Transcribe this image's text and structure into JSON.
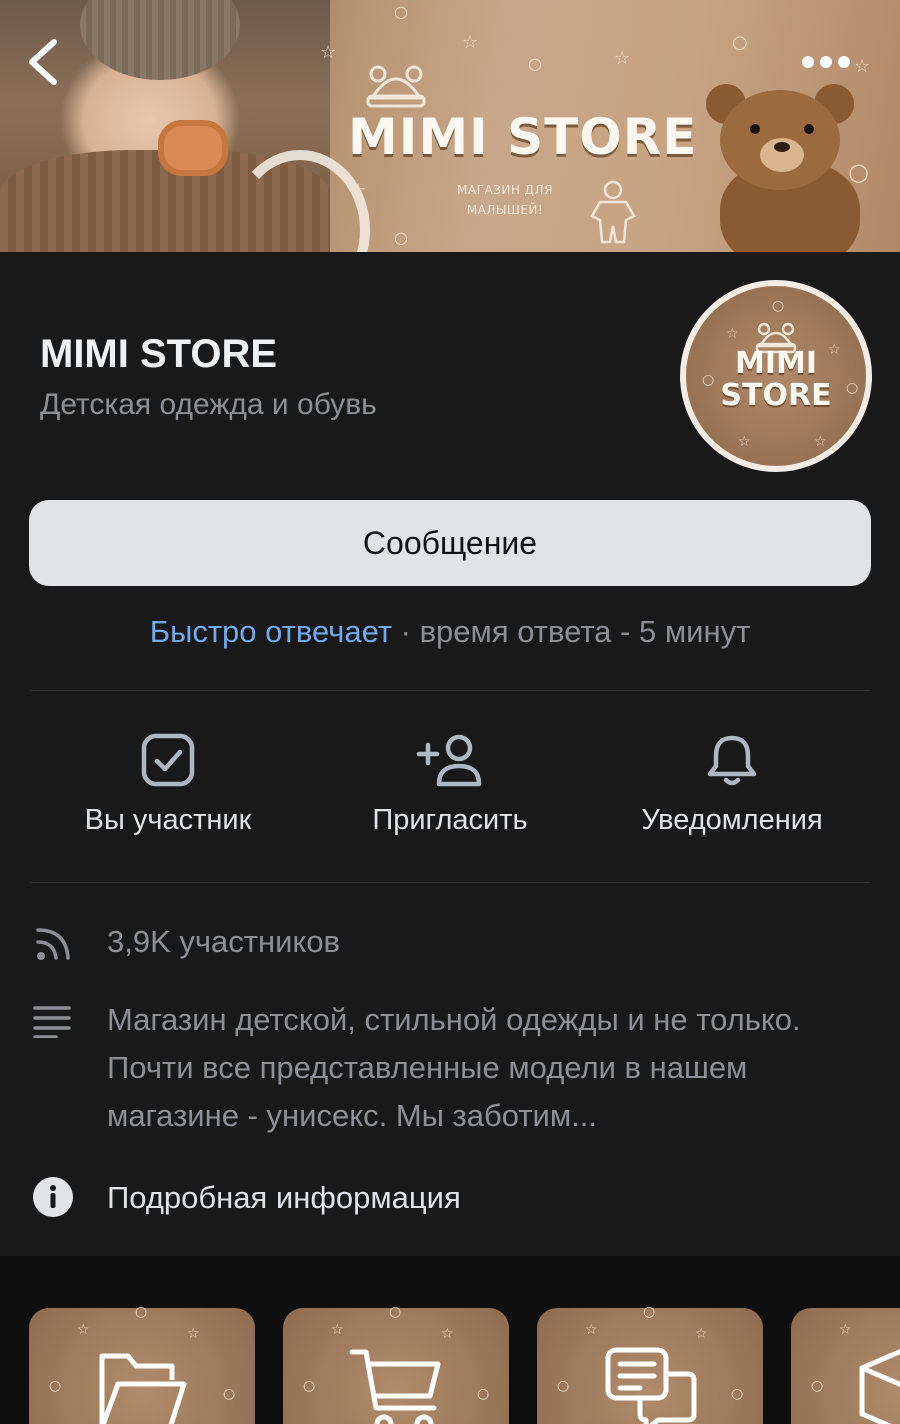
{
  "cover": {
    "brand": "MIMI STORE",
    "tagline_line1": "МАГАЗИН ДЛЯ",
    "tagline_line2": "МАЛЫШЕЙ!"
  },
  "header": {
    "back_icon": "chevron-left-icon",
    "more_icon": "more-dots-icon"
  },
  "profile": {
    "name": "MIMI STORE",
    "subtitle": "Детская одежда и обувь",
    "avatar_line1": "MIMI",
    "avatar_line2": "STORE"
  },
  "message_button": "Сообщение",
  "response": {
    "fast": "Быстро отвечает",
    "rest": " · время ответа - 5 минут"
  },
  "actions": [
    {
      "icon": "check-square-icon",
      "label": "Вы участник"
    },
    {
      "icon": "add-user-icon",
      "label": "Пригласить"
    },
    {
      "icon": "bell-icon",
      "label": "Уведомления"
    }
  ],
  "info": {
    "members": "3,9K участников",
    "description": "Магазин детской, стильной одежды и не только. Почти все представленные модели в нашем магазине - унисекс. Мы заботим...",
    "details": "Подробная информация"
  },
  "colors": {
    "accent": "#71aaeb",
    "card_bg": "#19191a",
    "button_bg": "#e1e3e6",
    "tile_brown": "#a88567"
  },
  "tiles": [
    {
      "icon": "folder-icon"
    },
    {
      "icon": "cart-icon"
    },
    {
      "icon": "chat-icon"
    },
    {
      "icon": "box-icon"
    }
  ]
}
